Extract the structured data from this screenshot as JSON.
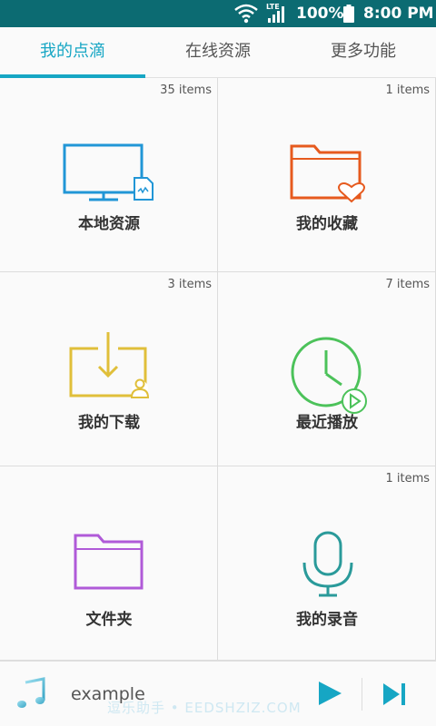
{
  "status_bar": {
    "network_label": "LTE",
    "battery_percent": "100%",
    "time": "8:00 PM",
    "icons": [
      "wifi-icon",
      "signal-icon",
      "battery-icon"
    ]
  },
  "tabs": [
    {
      "label": "我的点滴",
      "active": true
    },
    {
      "label": "在线资源",
      "active": false
    },
    {
      "label": "更多功能",
      "active": false
    }
  ],
  "grid": [
    {
      "label": "本地资源",
      "count": "35 items",
      "icon": "monitor-file-icon",
      "color": "#2196d6"
    },
    {
      "label": "我的收藏",
      "count": "1 items",
      "icon": "folder-heart-icon",
      "color": "#e65a1e"
    },
    {
      "label": "我的下载",
      "count": "3 items",
      "icon": "download-tray-icon",
      "color": "#e0bf3a"
    },
    {
      "label": "最近播放",
      "count": "7 items",
      "icon": "clock-play-icon",
      "color": "#4cc25a"
    },
    {
      "label": "文件夹",
      "count": "",
      "icon": "folder-icon",
      "color": "#b05ad8"
    },
    {
      "label": "我的录音",
      "count": "1 items",
      "icon": "microphone-icon",
      "color": "#2a9a9a"
    }
  ],
  "player": {
    "track": "example",
    "watermark": "逗乐助手 • EEDSHZIZ.COM",
    "accent": "#16a6c4"
  }
}
